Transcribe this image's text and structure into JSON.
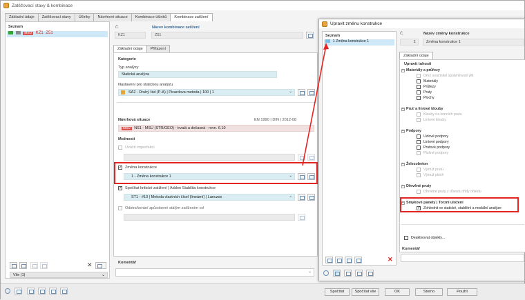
{
  "main_window": {
    "title": "Zatěžovací stavy & kombinace",
    "tabs": [
      "Základní údaje",
      "Zatěžovací stavy",
      "Účinky",
      "Návrhové situace",
      "Kombinace účinků",
      "Kombinace zatížení"
    ],
    "active_tab_index": 5,
    "list_header": "Seznam",
    "list_item": {
      "badge": "MSÚ",
      "id": "KZ1",
      "name": "Z51"
    },
    "no_label": "Č.",
    "no_value": "KZ1",
    "name_label": "Název kombinace zatížení",
    "name_value": "Z51",
    "inner_tabs": [
      "Základní údaje",
      "Přiřazení"
    ],
    "kategorie": "Kategorie",
    "typ_analyzy_label": "Typ analýzy",
    "typ_analyzy_value": "Statická analýza",
    "nastaveni_label": "Nastavení pro statickou analýzu",
    "nastaveni_value": "SA2 - Druhý řád (P-Δ) | Picardova metoda | 100 | 1",
    "navrhova_label": "Návrhová situace",
    "navrhova_norm": "EN 1990 | DIN | 2012-08",
    "navrhova_badge": "MSÚ",
    "navrhova_value": "NS1 - MSÚ (STR/GEO) - trvalá a dočasná - rovn. 6.10",
    "moznosti": "Možnosti",
    "uvazit_imperfekci": "Uvážit imperfekci",
    "zmena_konstrukce_label": "Změna konstrukce",
    "zmena_konstrukce_value": "1 - Změna konstrukce 1",
    "spocitat_label": "Spočítat kritické zatížení | Addon Stabilita konstrukce",
    "spocitat_value": "ST1 - #10 | Metoda vlastních čísel (lineární) | Lanczos",
    "odstranovani_label": "Odstraňování způsobené stálým zatížením od",
    "komentar_label": "Komentář",
    "filter_value": "Vše (1)"
  },
  "dialog": {
    "title": "Upravit změnu konstrukce",
    "list_header": "Seznam",
    "list_item": "1  Změna konstrukce 1",
    "no_label": "Č.",
    "no_value": "1",
    "name_label": "Název změny konstrukce",
    "name_value": "Změna konstrukce 1",
    "tab": "Základní údaje",
    "section": "Upravit tuhosti",
    "groups": [
      {
        "title": "Materiály a průřezy",
        "items": [
          {
            "label": "Ořez součinitel spolehlivosti γM",
            "checked": false,
            "disabled": true
          },
          {
            "label": "Materiály",
            "checked": false,
            "disabled": false
          },
          {
            "label": "Průřezy",
            "checked": false,
            "disabled": false
          },
          {
            "label": "Pruty",
            "checked": false,
            "disabled": false
          },
          {
            "label": "Plochy",
            "checked": false,
            "disabled": false
          }
        ]
      },
      {
        "title": "Pruť a liniové klouby",
        "items": [
          {
            "label": "Klouby na koncích prutu",
            "checked": false,
            "disabled": true
          },
          {
            "label": "Liniové klouby",
            "checked": false,
            "disabled": true
          }
        ]
      },
      {
        "title": "Podpory",
        "items": [
          {
            "label": "Uzlové podpory",
            "checked": false,
            "disabled": false
          },
          {
            "label": "Liniové podpory",
            "checked": false,
            "disabled": false
          },
          {
            "label": "Prutové podpory",
            "checked": false,
            "disabled": false
          },
          {
            "label": "Plošné podpory",
            "checked": false,
            "disabled": true
          }
        ]
      },
      {
        "title": "Železobeton",
        "items": [
          {
            "label": "Výztuž prutu",
            "checked": false,
            "disabled": true
          },
          {
            "label": "Výztuž ploch",
            "checked": false,
            "disabled": true
          }
        ]
      },
      {
        "title": "Dřevěné pruty",
        "items": [
          {
            "label": "Dřevěné pruty z důvodu třídy ohledu",
            "checked": false,
            "disabled": true
          }
        ]
      },
      {
        "title": "Smykové panely | Torzní uložení",
        "items": [
          {
            "label": "Zohlednit ve statické, stabilitní a modální analýze",
            "checked": true,
            "disabled": false
          }
        ]
      }
    ],
    "deaktivovat": "Deaktivovat objekty...",
    "komentar_label": "Komentář"
  },
  "footer_buttons": [
    "Spočítat",
    "Spočítat vše",
    "OK",
    "Storno",
    "Použít"
  ],
  "colors": {
    "accent_red": "#e42323",
    "value_bg": "#d9edf3",
    "badge_red": "#d9534f",
    "selected": "#cfe8f7"
  }
}
